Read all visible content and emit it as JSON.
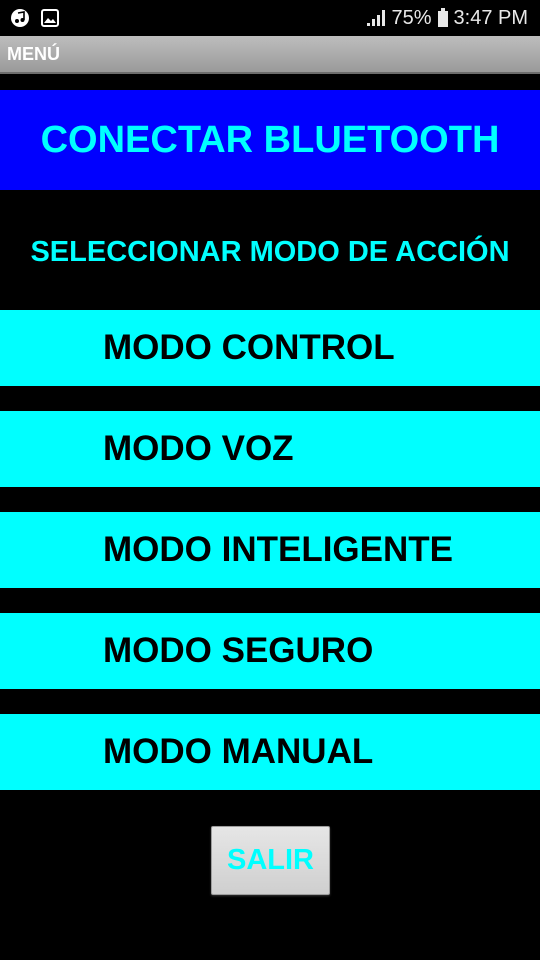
{
  "status_bar": {
    "left_icons": [
      "music-note-icon",
      "image-icon"
    ],
    "signal_icon": "signal-bars-icon",
    "battery_percent": "75%",
    "battery_icon": "battery-icon",
    "time": "3:47 PM"
  },
  "title_bar": {
    "title": "MENÚ",
    "background": "#a8a8a8"
  },
  "bluetooth": {
    "label": "CONECTAR BLUETOOTH",
    "background": "#0000ff",
    "text_color": "#00ffff"
  },
  "mode_section": {
    "label": "SELECCIONAR MODO DE ACCIÓN",
    "text_color": "#00ffff"
  },
  "modes": [
    {
      "label": "MODO CONTROL"
    },
    {
      "label": "MODO VOZ"
    },
    {
      "label": "MODO INTELIGENTE"
    },
    {
      "label": "MODO SEGURO"
    },
    {
      "label": "MODO MANUAL"
    }
  ],
  "mode_button_colors": {
    "background": "#00ffff",
    "text": "#000000"
  },
  "exit": {
    "label": "SALIR",
    "text_color": "#00ffff"
  }
}
